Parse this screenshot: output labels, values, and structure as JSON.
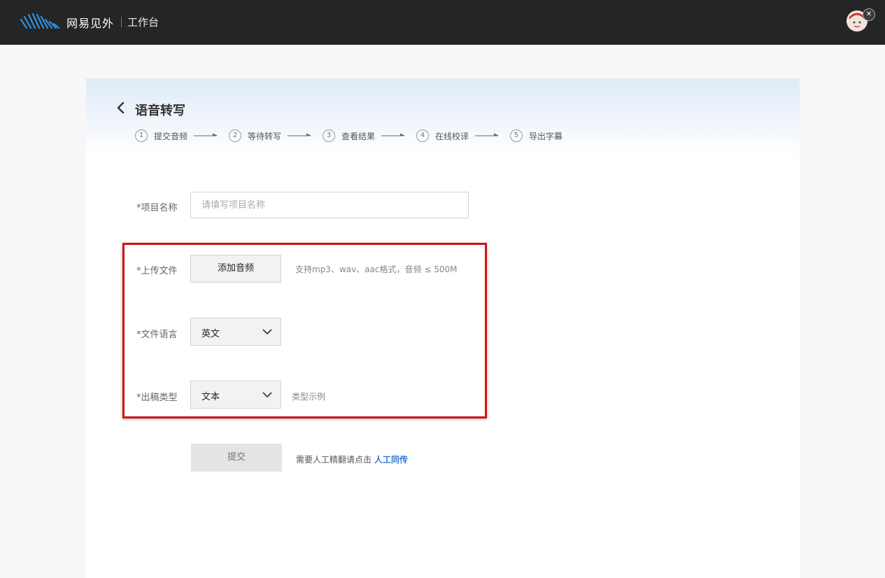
{
  "header": {
    "brand": "网易见外",
    "sub": "工作台"
  },
  "page": {
    "title": "语音转写",
    "steps": [
      {
        "num": "1",
        "label": "提交音频"
      },
      {
        "num": "2",
        "label": "等待转写"
      },
      {
        "num": "3",
        "label": "查看结果"
      },
      {
        "num": "4",
        "label": "在线校译"
      },
      {
        "num": "5",
        "label": "导出字幕"
      }
    ]
  },
  "form": {
    "project_name": {
      "label": "*项目名称",
      "value": "",
      "placeholder": "请填写项目名称"
    },
    "upload": {
      "label": "*上传文件",
      "button": "添加音频",
      "hint": "支持mp3、wav、aac格式，音频 ≤ 500M"
    },
    "language": {
      "label": "*文件语言",
      "value": "英文"
    },
    "output_type": {
      "label": "*出稿类型",
      "value": "文本",
      "hint": "类型示例"
    },
    "submit": {
      "label": "提交",
      "note": "需要人工精翻请点击",
      "link": "人工同传"
    }
  },
  "colors": {
    "topbar": "#252525",
    "highlight_border": "#d21515",
    "link": "#2f7dd4"
  },
  "icons": [
    "logo-icon",
    "avatar",
    "back-arrow-icon",
    "chevron-down-icon",
    "step-arrow-icon"
  ]
}
